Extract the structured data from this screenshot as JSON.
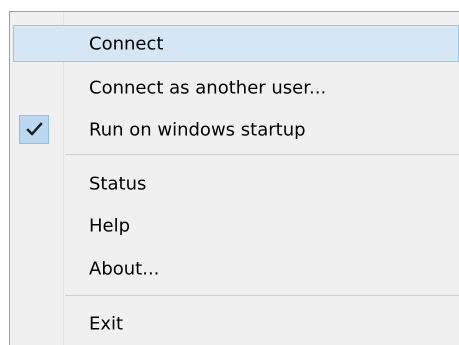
{
  "menu": {
    "items": [
      {
        "label": "Connect"
      },
      {
        "label": "Connect as another user..."
      },
      {
        "label": "Run on windows startup",
        "checked": true
      },
      {
        "label": "Status"
      },
      {
        "label": "Help"
      },
      {
        "label": "About..."
      },
      {
        "label": "Exit"
      }
    ]
  },
  "icons": {
    "checkmark": "check-icon"
  },
  "colors": {
    "hover_background": "#d5e6f5",
    "hover_border": "#9fc4e8",
    "check_background": "#bcd8f0",
    "menu_background": "#f0f0f0"
  }
}
